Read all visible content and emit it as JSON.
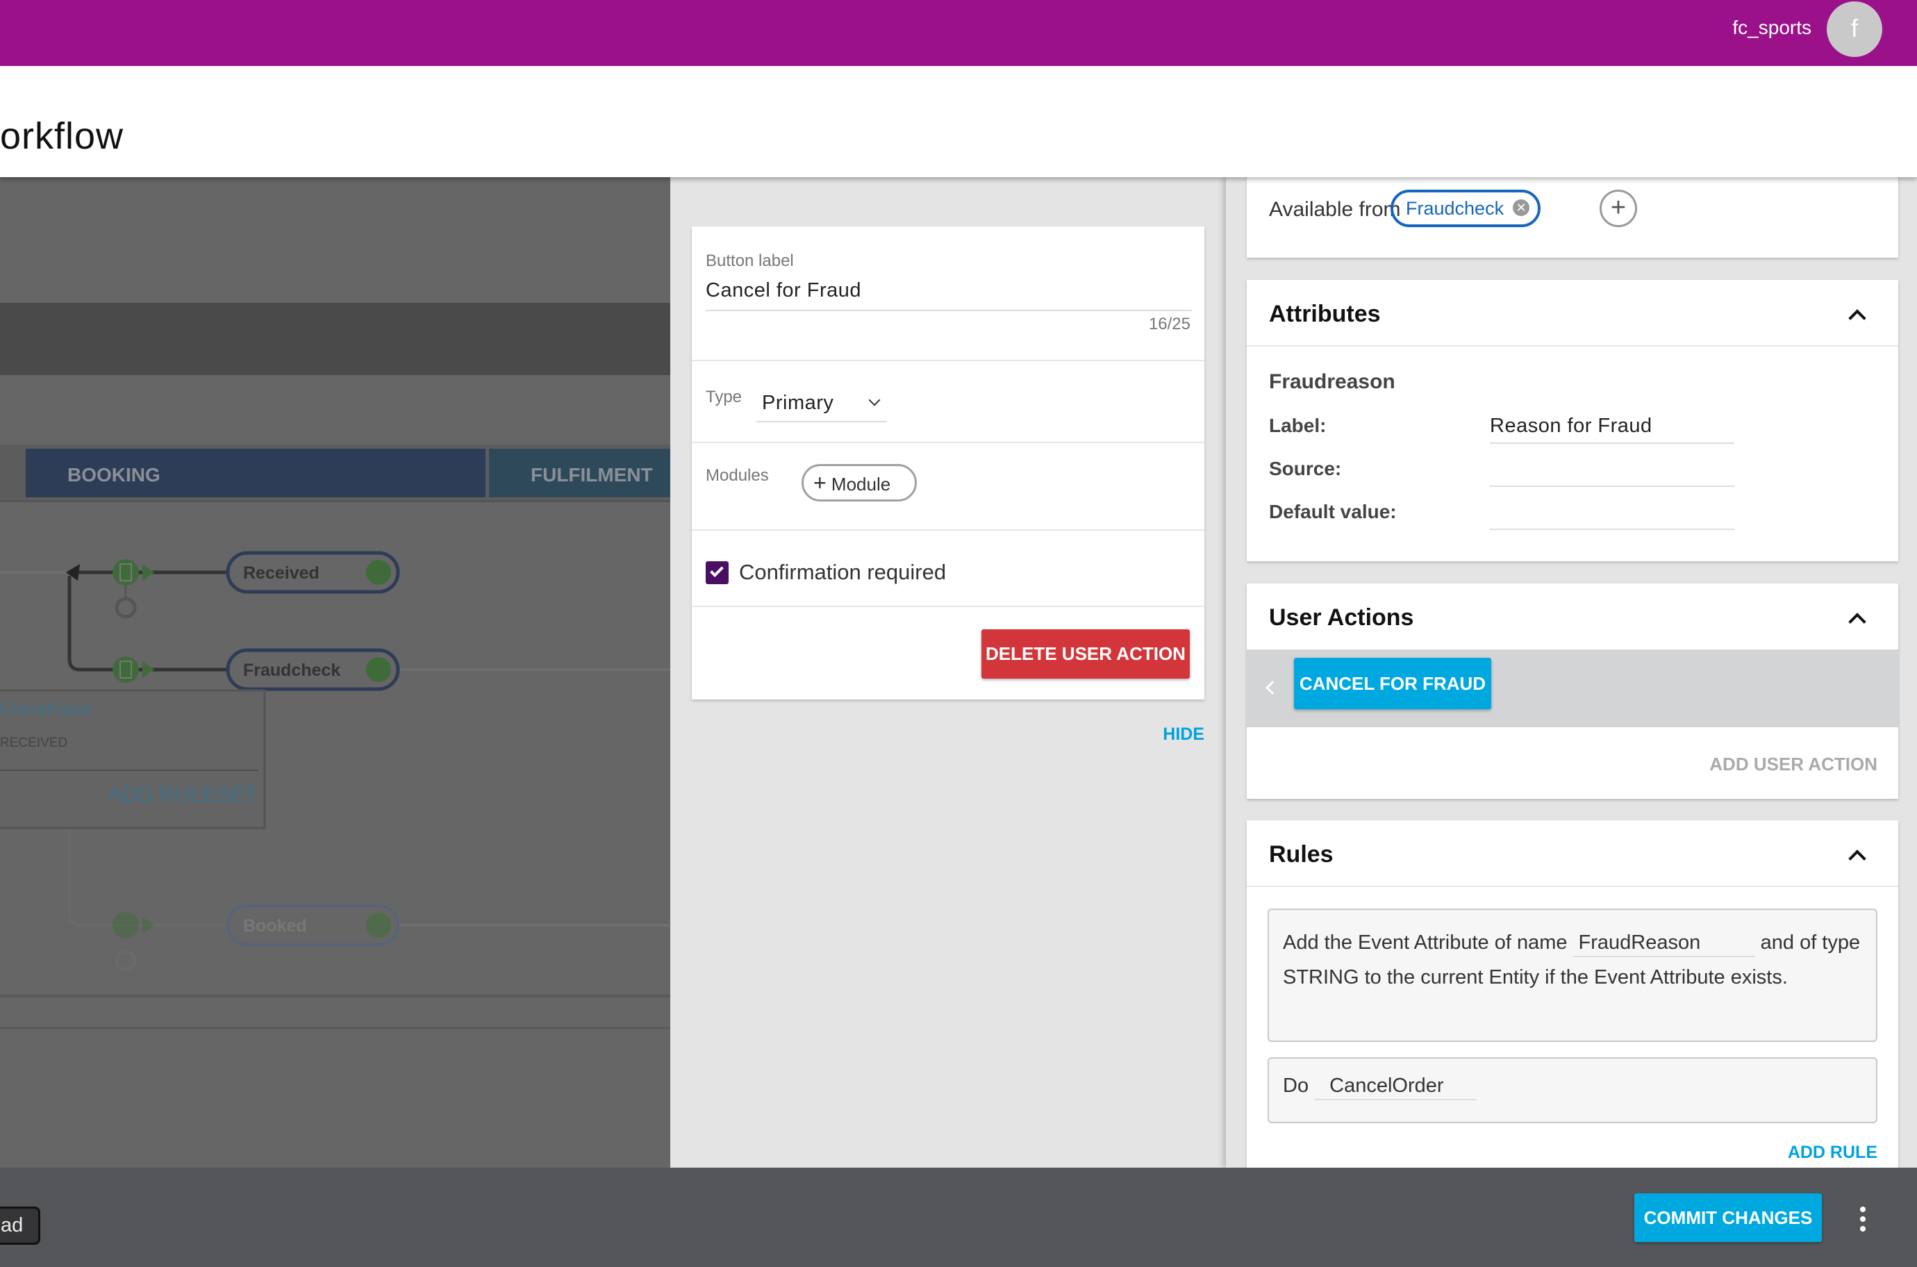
{
  "topbar": {
    "username": "fc_sports",
    "avatar_letter": "f",
    "color": "#9a1189"
  },
  "header": {
    "title": "orkflow"
  },
  "canvas": {
    "phases": [
      "BOOKING",
      "FULFILMENT"
    ],
    "nodes": [
      "Received",
      "Fraudcheck",
      "Booked"
    ],
    "popup": {
      "ruleset_name": "CheckFraud",
      "trigger": "RECEIVED",
      "add_ruleset": "ADD RULESET"
    }
  },
  "editor": {
    "button_label_caption": "Button label",
    "button_label_value": "Cancel for Fraud",
    "char_count": "16/25",
    "type_caption": "Type",
    "type_value": "Primary",
    "modules_caption": "Modules",
    "add_module": "Module",
    "confirmation_label": "Confirmation required",
    "confirmation_checked": true,
    "delete_button": "DELETE USER ACTION",
    "hide": "HIDE"
  },
  "status": {
    "available_from_label": "Available from",
    "available_from_chip": "Fraudcheck"
  },
  "attributes": {
    "title": "Attributes",
    "name": "Fraudreason",
    "label_caption": "Label:",
    "label_value": "Reason for Fraud",
    "source_caption": "Source:",
    "source_value": "",
    "default_caption": "Default value:",
    "default_value": ""
  },
  "user_actions": {
    "title": "User Actions",
    "items": [
      "CANCEL FOR FRAUD"
    ],
    "add": "ADD USER ACTION"
  },
  "rules": {
    "title": "Rules",
    "rule1_pre": "Add the Event Attribute of name",
    "rule1_input": "FraudReason",
    "rule1_mid": "and",
    "rule1_post": "of type STRING to the current Entity if the Event Attribute exists.",
    "rule2_pre": "Do",
    "rule2_input": "CancelOrder",
    "add": "ADD RULE"
  },
  "bottombar": {
    "left_button": "ad",
    "commit": "COMMIT CHANGES",
    "more_icon": "kebab-menu-icon"
  },
  "colors": {
    "accent": "#00a8e0",
    "danger": "#d3363a",
    "checkbox": "#4a0f63"
  }
}
